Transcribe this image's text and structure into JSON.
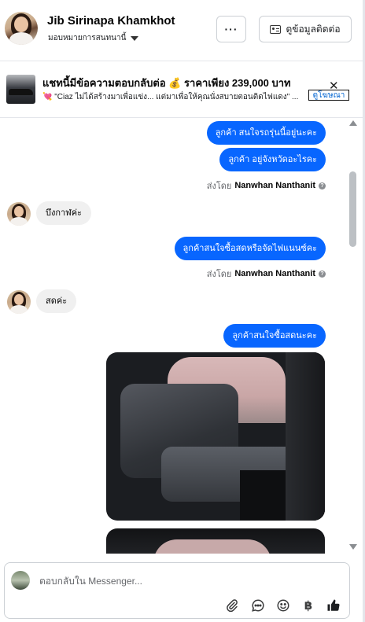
{
  "header": {
    "name": "Jib Sirinapa Khamkhot",
    "assign_label": "มอบหมายการสนทนานี้",
    "more_label": "···",
    "contact_label": "ดูข้อมูลติดต่อ"
  },
  "banner": {
    "title": "แชทนี้มีข้อความตอบกลับต่อ 💰 ราคาเพียง 239,000 บาท",
    "subtitle": "💘 \"Ciaz ไม่ได้สร้างมาเพื่อแข่ง... แต่มาเพื่อให้คุณนั่งสบายตอนติดไฟแดง\" ...",
    "link_label": "ดูโฆษณา"
  },
  "messages": {
    "out_1": "ลูกค้า สนใจรถรุ่นนี้อยู่นะคะ",
    "out_2": "ลูกค้า อยู่จังหวัดอะไรคะ",
    "sent_by_prefix": "ส่งโดย",
    "sent_by_name": "Nanwhan Nanthanit",
    "in_1": "บึงกาฬค่ะ",
    "out_3": "ลูกค้าสนใจซื้อสดหรือจัดไฟแนนซ์คะ",
    "in_2": "สดค่ะ",
    "out_4": "ลูกค้าสนใจซื้อสดนะคะ"
  },
  "composer": {
    "placeholder": "ตอบกลับใน Messenger..."
  },
  "icons": {
    "attach": "paperclip-icon",
    "saved_reply": "chat-bubble-icon",
    "emoji": "smiley-icon",
    "payment": "baht-icon",
    "like": "thumbs-up-icon"
  },
  "colors": {
    "outgoing_bubble": "#0866ff",
    "incoming_bubble": "#f0f0f0",
    "link": "#0064d1"
  }
}
